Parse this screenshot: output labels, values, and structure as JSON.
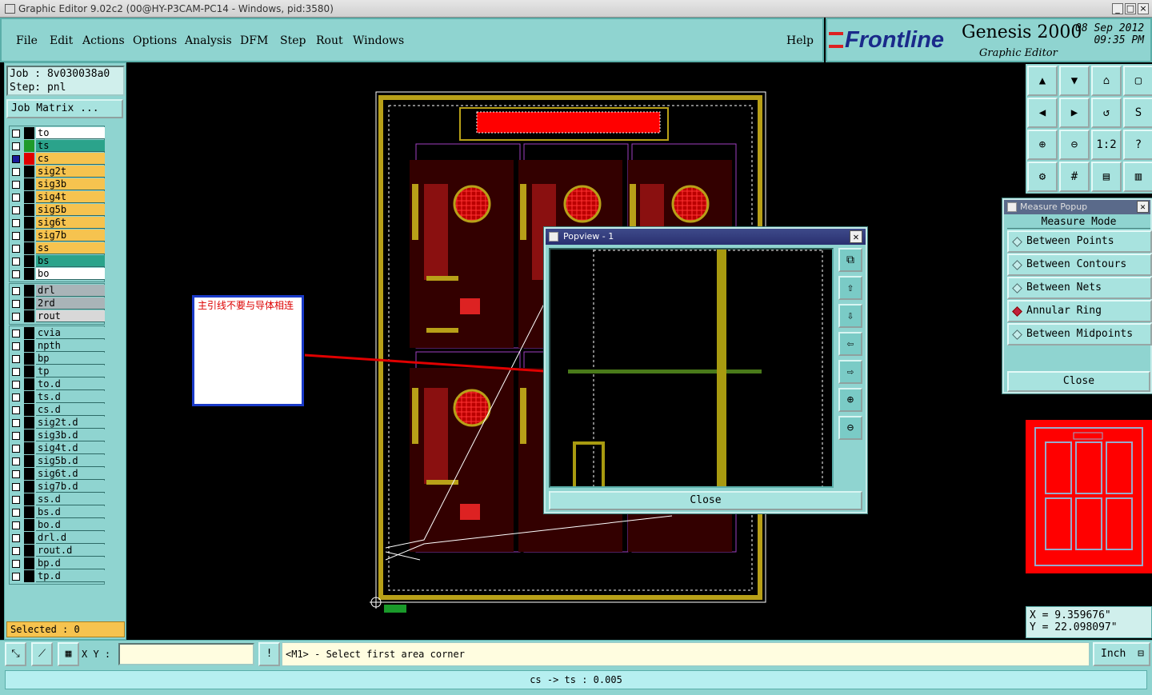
{
  "window": {
    "title": "Graphic Editor 9.02c2 (00@HY-P3CAM-PC14 - Windows, pid:3580)",
    "controls": [
      "_",
      "□",
      "×"
    ]
  },
  "menubar": {
    "items": [
      "File",
      "Edit",
      "Actions",
      "Options",
      "Analysis",
      "DFM",
      "Step",
      "Rout",
      "Windows"
    ],
    "help": "Help"
  },
  "brand": {
    "logo": "Frontline",
    "product": "Genesis 2000",
    "subtitle": "Graphic Editor",
    "date": "08 Sep 2012",
    "time": "09:35 PM"
  },
  "job": {
    "job_line": "Job : 8v030038a0",
    "step_line": "Step: pnl",
    "matrix_button": "Job Matrix ..."
  },
  "layers": {
    "board": [
      {
        "name": "to",
        "color": "#ffffff",
        "swatch": "#000000",
        "checked": false
      },
      {
        "name": "ts",
        "color": "#2ba38b",
        "swatch": "#1f9a2a",
        "checked": false
      },
      {
        "name": "cs",
        "color": "#f6c34f",
        "swatch": "#e00000",
        "checked": true,
        "marker": "⊞"
      },
      {
        "name": "sig2t",
        "color": "#f6c34f",
        "swatch": "#000000",
        "checked": false
      },
      {
        "name": "sig3b",
        "color": "#f6c34f",
        "swatch": "#000000",
        "checked": false
      },
      {
        "name": "sig4t",
        "color": "#f6c34f",
        "swatch": "#000000",
        "checked": false
      },
      {
        "name": "sig5b",
        "color": "#f6c34f",
        "swatch": "#000000",
        "checked": false
      },
      {
        "name": "sig6t",
        "color": "#f6c34f",
        "swatch": "#000000",
        "checked": false
      },
      {
        "name": "sig7b",
        "color": "#f6c34f",
        "swatch": "#000000",
        "checked": false
      },
      {
        "name": "ss",
        "color": "#f6c34f",
        "swatch": "#000000",
        "checked": false
      },
      {
        "name": "bs",
        "color": "#2ba38b",
        "swatch": "#000000",
        "checked": false
      },
      {
        "name": "bo",
        "color": "#ffffff",
        "swatch": "#000000",
        "checked": false
      }
    ],
    "drill": [
      {
        "name": "drl",
        "color": "#a9b4b8",
        "swatch": "#000000",
        "checked": false
      },
      {
        "name": "2rd",
        "color": "#a9b4b8",
        "swatch": "#000000",
        "checked": false
      },
      {
        "name": "rout",
        "color": "#d8d8d8",
        "swatch": "#000000",
        "checked": false
      }
    ],
    "misc": [
      {
        "name": "cvia",
        "color": "#8fd4d0",
        "swatch": "#000000",
        "checked": false
      },
      {
        "name": "npth",
        "color": "#8fd4d0",
        "swatch": "#000000",
        "checked": false
      },
      {
        "name": "bp",
        "color": "#8fd4d0",
        "swatch": "#000000",
        "checked": false
      },
      {
        "name": "tp",
        "color": "#8fd4d0",
        "swatch": "#000000",
        "checked": false
      },
      {
        "name": "to.d",
        "color": "#8fd4d0",
        "swatch": "#000000",
        "checked": false
      },
      {
        "name": "ts.d",
        "color": "#8fd4d0",
        "swatch": "#000000",
        "checked": false
      },
      {
        "name": "cs.d",
        "color": "#8fd4d0",
        "swatch": "#000000",
        "checked": false
      },
      {
        "name": "sig2t.d",
        "color": "#8fd4d0",
        "swatch": "#000000",
        "checked": false
      },
      {
        "name": "sig3b.d",
        "color": "#8fd4d0",
        "swatch": "#000000",
        "checked": false
      },
      {
        "name": "sig4t.d",
        "color": "#8fd4d0",
        "swatch": "#000000",
        "checked": false
      },
      {
        "name": "sig5b.d",
        "color": "#8fd4d0",
        "swatch": "#000000",
        "checked": false
      },
      {
        "name": "sig6t.d",
        "color": "#8fd4d0",
        "swatch": "#000000",
        "checked": false
      },
      {
        "name": "sig7b.d",
        "color": "#8fd4d0",
        "swatch": "#000000",
        "checked": false
      },
      {
        "name": "ss.d",
        "color": "#8fd4d0",
        "swatch": "#000000",
        "checked": false
      },
      {
        "name": "bs.d",
        "color": "#8fd4d0",
        "swatch": "#000000",
        "checked": false
      },
      {
        "name": "bo.d",
        "color": "#8fd4d0",
        "swatch": "#000000",
        "checked": false
      },
      {
        "name": "drl.d",
        "color": "#8fd4d0",
        "swatch": "#000000",
        "checked": false
      },
      {
        "name": "rout.d",
        "color": "#8fd4d0",
        "swatch": "#000000",
        "checked": false
      },
      {
        "name": "bp.d",
        "color": "#8fd4d0",
        "swatch": "#000000",
        "checked": false
      },
      {
        "name": "tp.d",
        "color": "#8fd4d0",
        "swatch": "#000000",
        "checked": false
      }
    ]
  },
  "selected_text": "Selected : 0",
  "annotation": {
    "text": "主引线不要与导体相连",
    "arrow_color": "#e00000"
  },
  "popview": {
    "title": "Popview - 1",
    "close_label": "Close",
    "tools": [
      "zoom-window-icon",
      "pan-up-icon",
      "pan-down-icon",
      "pan-left-icon",
      "pan-right-icon",
      "zoom-in-icon",
      "zoom-out-icon"
    ]
  },
  "toolbar": {
    "buttons": [
      {
        "icon": "pan-up-icon",
        "glyph": "▲"
      },
      {
        "icon": "pan-down-icon",
        "glyph": "▼"
      },
      {
        "icon": "home-icon",
        "glyph": "⌂"
      },
      {
        "icon": "zoom-region-icon",
        "glyph": "▢"
      },
      {
        "icon": "pan-left-icon",
        "glyph": "◀"
      },
      {
        "icon": "pan-right-icon",
        "glyph": "▶"
      },
      {
        "icon": "undo-view-icon",
        "glyph": "↺"
      },
      {
        "icon": "snap-icon",
        "glyph": "S"
      },
      {
        "icon": "zoom-in-icon",
        "glyph": "⊕"
      },
      {
        "icon": "zoom-out-icon",
        "glyph": "⊖"
      },
      {
        "icon": "one-to-one-icon",
        "glyph": "1:2"
      },
      {
        "icon": "help-icon",
        "glyph": "?"
      },
      {
        "icon": "tools-icon",
        "glyph": "⚙"
      },
      {
        "icon": "grid-icon",
        "glyph": "#"
      },
      {
        "icon": "layer-display-icon",
        "glyph": "▤"
      },
      {
        "icon": "layer-display-alt-icon",
        "glyph": "▥"
      }
    ]
  },
  "measure": {
    "title": "Measure Popup",
    "mode_label": "Measure Mode",
    "options": [
      {
        "label": "Between Points",
        "active": false
      },
      {
        "label": "Between Contours",
        "active": false
      },
      {
        "label": "Between Nets",
        "active": false
      },
      {
        "label": "Annular Ring",
        "active": true
      },
      {
        "label": "Between Midpoints",
        "active": false
      }
    ],
    "close_label": "Close"
  },
  "coords": {
    "x": "X = 9.359676\"",
    "y": "Y = 22.098097\""
  },
  "bottom": {
    "xy_label": "X Y :",
    "xy_value": "",
    "exclaim": "!",
    "prompt": "<M1> - Select first area corner",
    "unit": "Inch",
    "status": "cs -> ts : 0.005"
  }
}
